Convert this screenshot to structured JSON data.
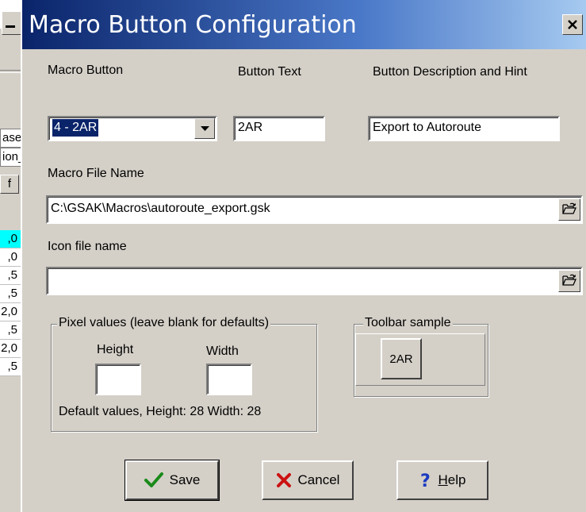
{
  "background_window": {
    "col_header_1": "ase",
    "col_header_2": "ion_N",
    "col_button": "f",
    "rows": [
      ",0",
      ",0",
      ",5",
      ",5",
      "2,0",
      ",5",
      "2,0",
      ",5"
    ]
  },
  "dialog": {
    "title": "Macro Button Configuration",
    "close_label": "×",
    "labels": {
      "macro_button": "Macro Button",
      "button_text": "Button Text",
      "button_description": "Button Description and Hint",
      "macro_file_name": "Macro File Name",
      "icon_file_name": "Icon file name"
    },
    "macro_button_value": "4 - 2AR",
    "button_text_value": "2AR",
    "button_description_value": "Export to Autoroute",
    "macro_file_value": "C:\\GSAK\\Macros\\autoroute_export.gsk",
    "icon_file_value": "",
    "pixel_group": {
      "title": "Pixel values (leave blank for defaults)",
      "height_label": "Height",
      "width_label": "Width",
      "height_value": "",
      "width_value": "",
      "defaults_text": "Default values, Height: 28 Width: 28"
    },
    "toolbar_group": {
      "title": "Toolbar sample",
      "sample_button": "2AR"
    },
    "buttons": {
      "save": "Save",
      "cancel": "Cancel",
      "help_underlined": "H",
      "help_rest": "elp"
    }
  },
  "icons": {
    "save": "checkmark-icon",
    "cancel": "x-mark-icon",
    "help": "question-mark-icon",
    "browse": "open-folder-icon",
    "dropdown": "chevron-down-icon"
  },
  "colors": {
    "title_start": "#0a246a",
    "title_end": "#a6caf0",
    "selection": "#0a246a",
    "face": "#d4d0c8",
    "highlight_cell": "#00ffff"
  }
}
